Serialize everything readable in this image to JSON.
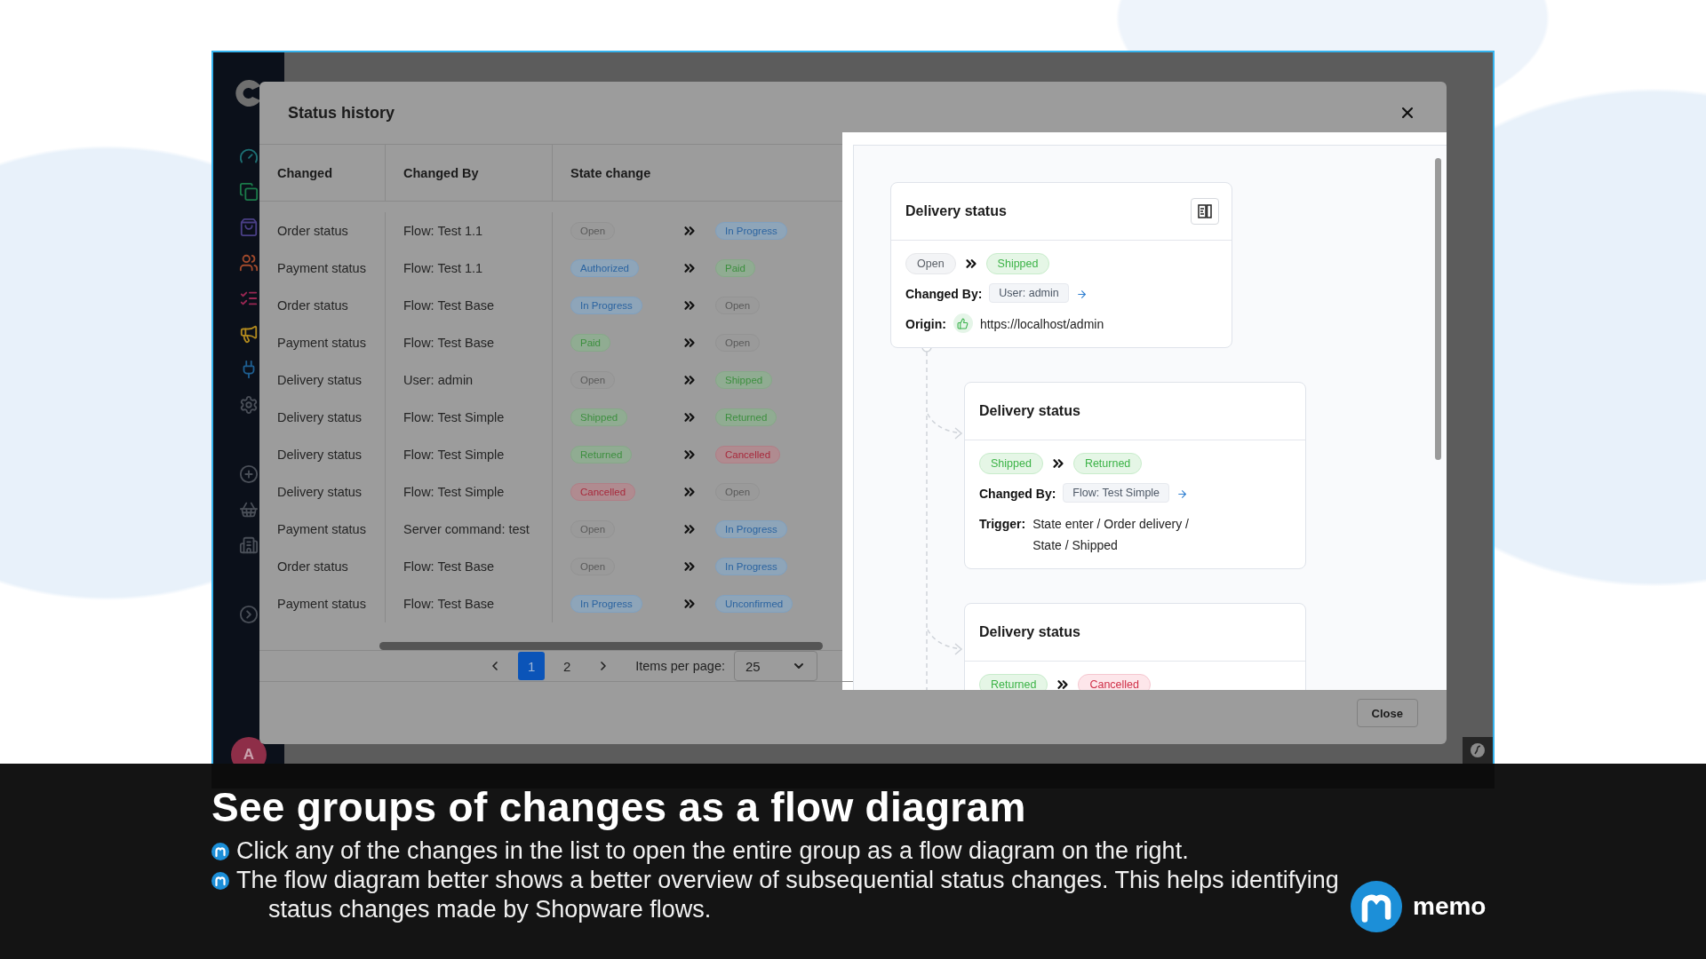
{
  "app": {
    "avatar": "A"
  },
  "modal": {
    "title": "Status history",
    "table": {
      "columns": [
        "Changed",
        "Changed By",
        "State change"
      ],
      "rows": [
        {
          "changed": "Order status",
          "changed_by": "Flow: Test 1.1",
          "from": {
            "label": "Open",
            "kind": "neutral"
          },
          "to": {
            "label": "In Progress",
            "kind": "info"
          }
        },
        {
          "changed": "Payment status",
          "changed_by": "Flow: Test 1.1",
          "from": {
            "label": "Authorized",
            "kind": "info"
          },
          "to": {
            "label": "Paid",
            "kind": "success"
          }
        },
        {
          "changed": "Order status",
          "changed_by": "Flow: Test Base",
          "from": {
            "label": "In Progress",
            "kind": "info"
          },
          "to": {
            "label": "Open",
            "kind": "neutral"
          }
        },
        {
          "changed": "Payment status",
          "changed_by": "Flow: Test Base",
          "from": {
            "label": "Paid",
            "kind": "success"
          },
          "to": {
            "label": "Open",
            "kind": "neutral"
          }
        },
        {
          "changed": "Delivery status",
          "changed_by": "User: admin",
          "from": {
            "label": "Open",
            "kind": "neutral"
          },
          "to": {
            "label": "Shipped",
            "kind": "success"
          }
        },
        {
          "changed": "Delivery status",
          "changed_by": "Flow: Test Simple",
          "from": {
            "label": "Shipped",
            "kind": "success"
          },
          "to": {
            "label": "Returned",
            "kind": "success"
          }
        },
        {
          "changed": "Delivery status",
          "changed_by": "Flow: Test Simple",
          "from": {
            "label": "Returned",
            "kind": "success"
          },
          "to": {
            "label": "Cancelled",
            "kind": "danger"
          }
        },
        {
          "changed": "Delivery status",
          "changed_by": "Flow: Test Simple",
          "from": {
            "label": "Cancelled",
            "kind": "danger"
          },
          "to": {
            "label": "Open",
            "kind": "neutral"
          }
        },
        {
          "changed": "Payment status",
          "changed_by": "Server command: test",
          "from": {
            "label": "Open",
            "kind": "neutral"
          },
          "to": {
            "label": "In Progress",
            "kind": "info"
          }
        },
        {
          "changed": "Order status",
          "changed_by": "Flow: Test Base",
          "from": {
            "label": "Open",
            "kind": "neutral"
          },
          "to": {
            "label": "In Progress",
            "kind": "info"
          }
        },
        {
          "changed": "Payment status",
          "changed_by": "Flow: Test Base",
          "from": {
            "label": "In Progress",
            "kind": "info"
          },
          "to": {
            "label": "Unconfirmed",
            "kind": "info"
          }
        }
      ]
    },
    "pagination": {
      "pages": [
        {
          "label": "1",
          "selected": true
        },
        {
          "label": "2",
          "selected": false
        }
      ],
      "items_per_page_label": "Items per page:",
      "items_per_page": "25"
    },
    "flow": {
      "cards": [
        {
          "kind": "root",
          "title": "Delivery status",
          "from": {
            "label": "Open",
            "kind": "neutral"
          },
          "to": {
            "label": "Shipped",
            "kind": "success"
          },
          "details": [
            {
              "kind": "changed_by",
              "label": "Changed By:",
              "value": "User: admin"
            },
            {
              "kind": "origin",
              "label": "Origin:",
              "value": "https://localhost/admin"
            }
          ]
        },
        {
          "kind": "child",
          "title": "Delivery status",
          "from": {
            "label": "Shipped",
            "kind": "success"
          },
          "to": {
            "label": "Returned",
            "kind": "success"
          },
          "details": [
            {
              "kind": "changed_by",
              "label": "Changed By:",
              "value": "Flow: Test Simple"
            },
            {
              "kind": "trigger",
              "label": "Trigger:",
              "value": "State enter / Order delivery / State / Shipped"
            }
          ]
        },
        {
          "kind": "child",
          "title": "Delivery status",
          "from": {
            "label": "Returned",
            "kind": "success"
          },
          "to": {
            "label": "Cancelled",
            "kind": "danger"
          }
        }
      ]
    },
    "close_button": "Close"
  },
  "caption": {
    "title": "See groups of changes as a flow diagram",
    "bullets": [
      "Click any of the changes in the list to open the entire group as a flow diagram on the right.",
      "The flow diagram better shows a better overview of subsequential status changes. This helps identifying status changes made by Shopware flows."
    ]
  },
  "brand": {
    "name": "memo"
  }
}
